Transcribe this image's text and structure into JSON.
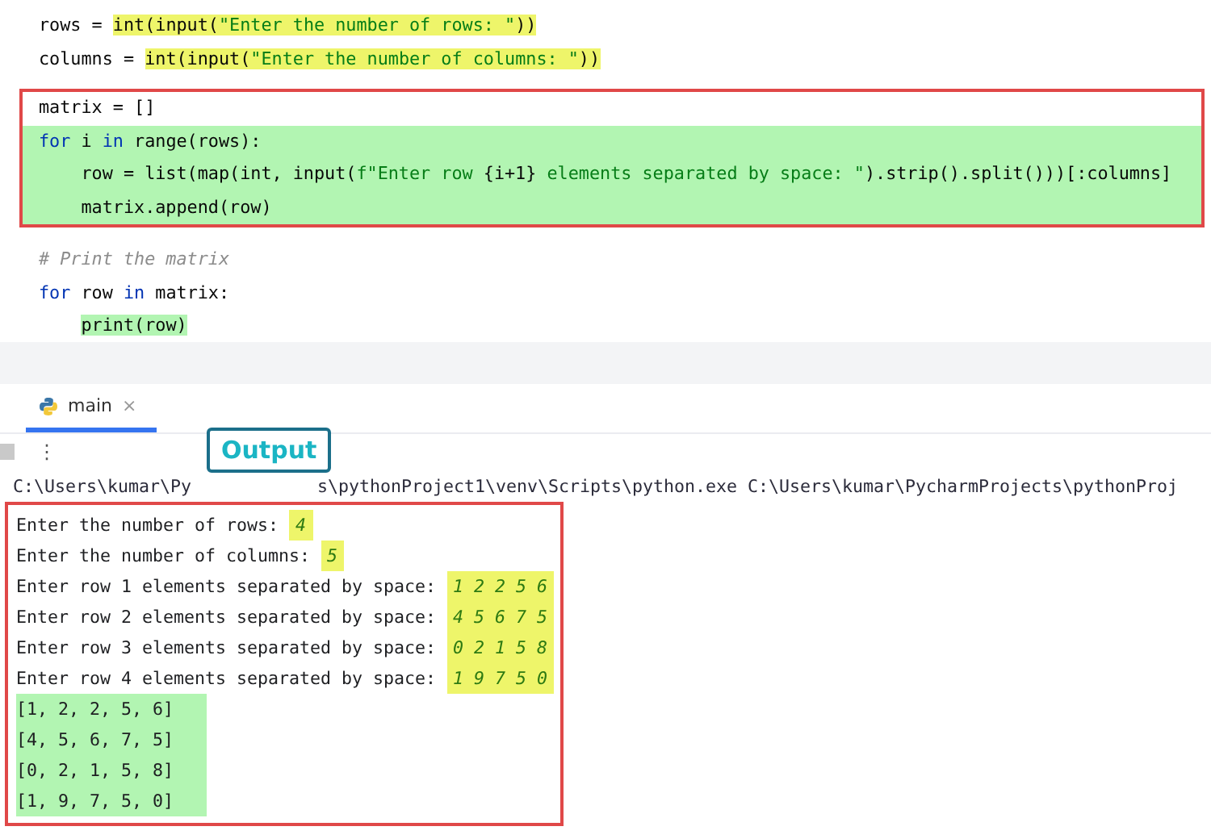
{
  "editor": {
    "blocks": [
      {
        "boxed": false,
        "lines": [
          {
            "tokens": [
              {
                "text": "rows = ",
                "kind": "name"
              },
              {
                "text": "int(input(",
                "kind": "name",
                "color": "#eef56a"
              },
              {
                "text": "\"Enter the number of rows: \"",
                "kind": "string",
                "color": "#eef56a"
              },
              {
                "text": "))",
                "kind": "name",
                "color": "#eef56a"
              }
            ]
          },
          {
            "tokens": [
              {
                "text": "columns = ",
                "kind": "name"
              },
              {
                "text": "int(input(",
                "kind": "name",
                "color": "#eef56a"
              },
              {
                "text": "\"Enter the number of columns: \"",
                "kind": "string",
                "color": "#eef56a"
              },
              {
                "text": "))",
                "kind": "name",
                "color": "#eef56a"
              }
            ]
          }
        ]
      },
      {
        "boxed": true,
        "lines": [
          {
            "tokens": [
              {
                "text": "matrix = []",
                "kind": "name"
              }
            ]
          },
          {
            "color": "#b2f5b2",
            "tokens": [
              {
                "text": "for",
                "kind": "keyword"
              },
              {
                "text": " i ",
                "kind": "name"
              },
              {
                "text": "in",
                "kind": "keyword"
              },
              {
                "text": " range(rows):",
                "kind": "name"
              }
            ]
          },
          {
            "color": "#b2f5b2",
            "tokens": [
              {
                "text": "    row = list(map(int, input(",
                "kind": "name"
              },
              {
                "text": "f\"Enter row ",
                "kind": "string"
              },
              {
                "text": "{i+1}",
                "kind": "name"
              },
              {
                "text": " elements separated by space: \"",
                "kind": "string"
              },
              {
                "text": ").strip().split()))[:columns]",
                "kind": "name"
              }
            ]
          },
          {
            "color": "#b2f5b2",
            "tokens": [
              {
                "text": "    matrix.append(row)",
                "kind": "name"
              }
            ]
          }
        ]
      },
      {
        "boxed": false,
        "lines": [
          {
            "tokens": [
              {
                "text": "# Print the matrix",
                "kind": "comment"
              }
            ]
          },
          {
            "tokens": [
              {
                "text": "for",
                "kind": "keyword"
              },
              {
                "text": " row ",
                "kind": "name"
              },
              {
                "text": "in",
                "kind": "keyword"
              },
              {
                "text": " matrix:",
                "kind": "name"
              }
            ]
          },
          {
            "tokens": [
              {
                "text": "    print(row)",
                "kind": "name",
                "color": "#b2f5b2"
              }
            ]
          }
        ]
      }
    ]
  },
  "run_panel": {
    "tabs": [
      {
        "label": "main",
        "close": "×",
        "selected": true
      }
    ],
    "menu_glyph": "⋮",
    "callout": "Output",
    "command_line": [
      "C:\\Users\\kumar\\Py",
      "s\\pythonProject1\\venv\\Scripts\\python.exe C:\\Users\\kumar\\PycharmProjects\\pythonProj"
    ],
    "console": [
      {
        "kind": "prompt",
        "text": "Enter the number of rows: ",
        "input": "4"
      },
      {
        "kind": "prompt",
        "text": "Enter the number of columns: ",
        "input": "5"
      },
      {
        "kind": "prompt",
        "text": "Enter row 1 elements separated by space: ",
        "input": "1 2 2 5 6"
      },
      {
        "kind": "prompt",
        "text": "Enter row 2 elements separated by space: ",
        "input": "4 5 6 7 5"
      },
      {
        "kind": "prompt",
        "text": "Enter row 3 elements separated by space: ",
        "input": "0 2 1 5 8"
      },
      {
        "kind": "prompt",
        "text": "Enter row 4 elements separated by space: ",
        "input": "1 9 7 5 0"
      },
      {
        "kind": "output",
        "text": "[1, 2, 2, 5, 6]"
      },
      {
        "kind": "output",
        "text": "[4, 5, 6, 7, 5]"
      },
      {
        "kind": "output",
        "text": "[0, 2, 1, 5, 8]"
      },
      {
        "kind": "output",
        "text": "[1, 9, 7, 5, 0]"
      }
    ]
  }
}
